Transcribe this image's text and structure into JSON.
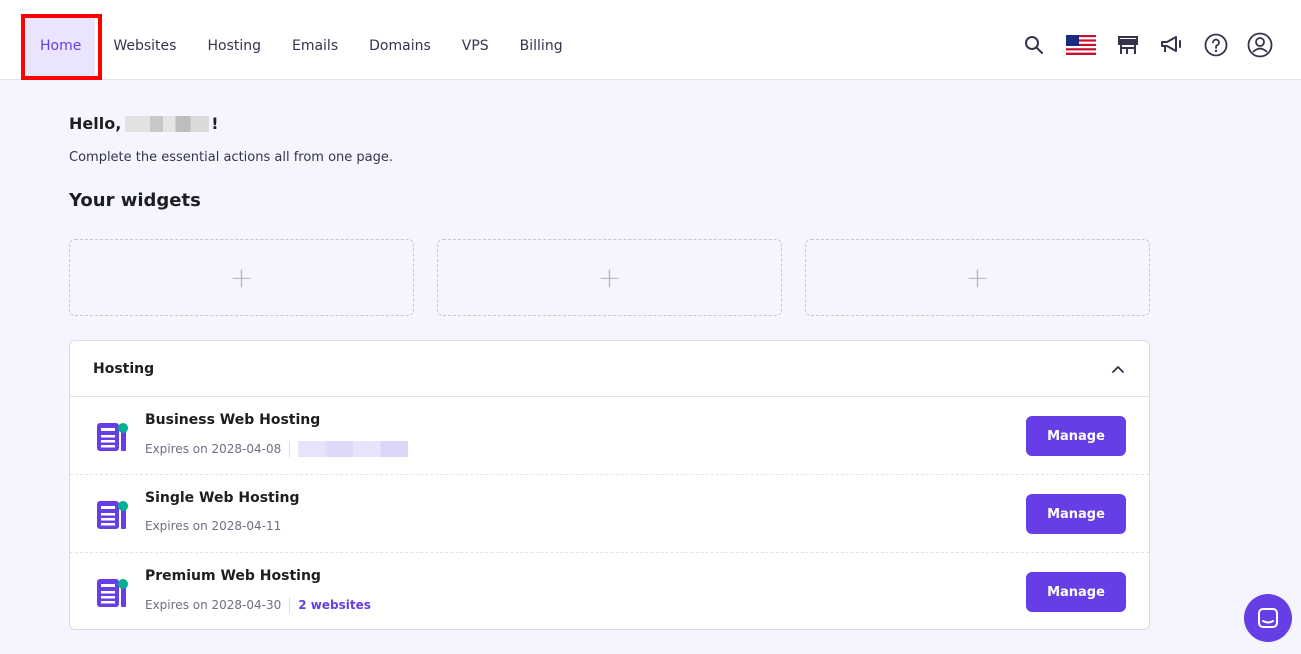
{
  "nav": {
    "items": [
      {
        "label": "Home",
        "active": true
      },
      {
        "label": "Websites"
      },
      {
        "label": "Hosting"
      },
      {
        "label": "Emails"
      },
      {
        "label": "Domains"
      },
      {
        "label": "VPS"
      },
      {
        "label": "Billing"
      }
    ],
    "icons": [
      "search-icon",
      "us-flag-icon",
      "store-icon",
      "megaphone-icon",
      "help-icon",
      "account-icon"
    ]
  },
  "greeting": {
    "prefix": "Hello,",
    "suffix": "!"
  },
  "subtitle": "Complete the essential actions all from one page.",
  "widgets": {
    "title": "Your widgets",
    "slots": [
      "+",
      "+",
      "+"
    ]
  },
  "hosting": {
    "title": "Hosting",
    "rows": [
      {
        "name": "Business Web Hosting",
        "expires": "Expires on 2028-04-08",
        "button": "Manage"
      },
      {
        "name": "Single Web Hosting",
        "expires": "Expires on 2028-04-11",
        "button": "Manage"
      },
      {
        "name": "Premium Web Hosting",
        "expires": "Expires on 2028-04-30",
        "websites": "2 websites",
        "button": "Manage"
      }
    ]
  },
  "colors": {
    "accent": "#673de6",
    "accent_light": "#ebe4ff",
    "page_bg": "#f4f5ff",
    "highlight": "#ff0000",
    "status_dot": "#00b090"
  }
}
